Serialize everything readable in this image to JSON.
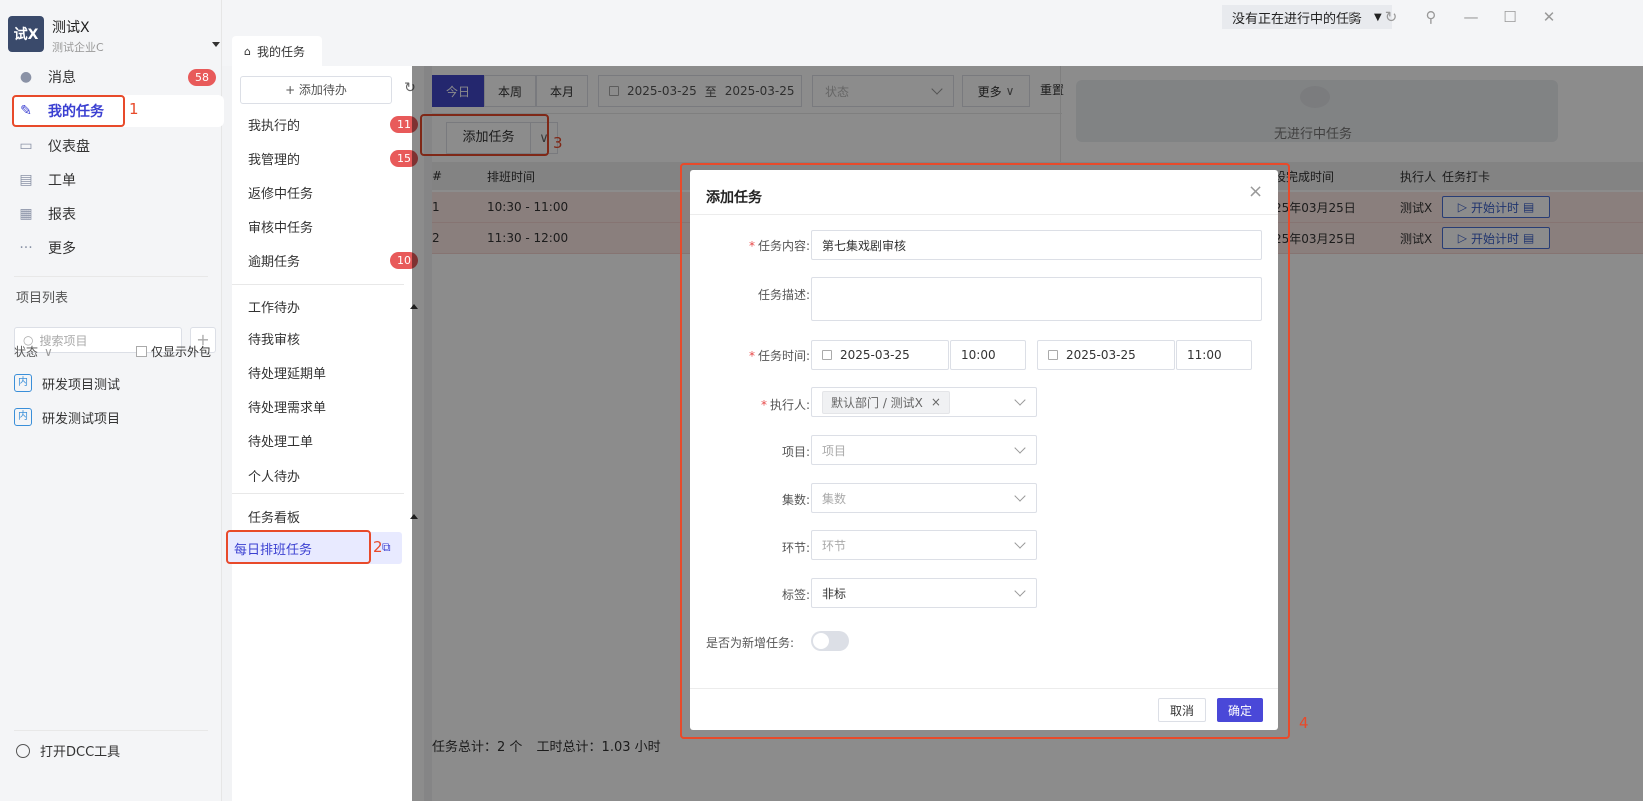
{
  "app": {
    "logo_text": "试X",
    "name": "测试X",
    "company": "测试企业C"
  },
  "sidebar": {
    "nav": [
      {
        "label": "消息",
        "icon": "message-icon",
        "badge": "58"
      },
      {
        "label": "我的任务",
        "icon": "task-icon",
        "badge": ""
      },
      {
        "label": "仪表盘",
        "icon": "dashboard-icon",
        "badge": ""
      },
      {
        "label": "工单",
        "icon": "workorder-icon",
        "badge": ""
      },
      {
        "label": "报表",
        "icon": "report-icon",
        "badge": ""
      },
      {
        "label": "更多",
        "icon": "more-icon",
        "badge": ""
      }
    ],
    "project_list_label": "项目列表",
    "search_placeholder": "搜索项目",
    "status_label": "状态",
    "outsource_only": "仅显示外包",
    "projects": [
      {
        "tag": "内",
        "name": "研发项目测试"
      },
      {
        "tag": "内",
        "name": "研发测试项目"
      }
    ],
    "open_dcc": "打开DCC工具"
  },
  "topbar": {
    "tab_home": "我的任务",
    "status_text": "没有正在进行中的任务"
  },
  "midpanel": {
    "add_todo": "+ 添加待办",
    "items": [
      {
        "label": "我执行的",
        "badge": "11"
      },
      {
        "label": "我管理的",
        "badge": "15"
      },
      {
        "label": "返修中任务",
        "badge": ""
      },
      {
        "label": "审核中任务",
        "badge": ""
      },
      {
        "label": "逾期任务",
        "badge": "10"
      }
    ],
    "group_work": "工作待办",
    "work_items": [
      "待我审核",
      "待处理延期单",
      "待处理需求单",
      "待处理工单",
      "个人待办"
    ],
    "group_board": "任务看板",
    "board_active": "每日排班任务"
  },
  "main": {
    "seg_today": "今日",
    "seg_week": "本周",
    "seg_month": "本月",
    "date_start": "2025-03-25",
    "date_sep": "至",
    "date_end": "2025-03-25",
    "status_placeholder": "状态",
    "more": "更多",
    "reset": "重置",
    "add_task": "添加任务",
    "no_task": "无进行中任务",
    "table_headers": {
      "idx": "#",
      "schedule": "排班时间",
      "finish": "设完成时间",
      "executor": "执行人",
      "clockin": "任务打卡"
    },
    "rows": [
      {
        "idx": "1",
        "time": "10:30 - 11:00",
        "finish": "25年03月25日",
        "executor": "测试X",
        "action": "开始计时"
      },
      {
        "idx": "2",
        "time": "11:30 - 12:00",
        "finish": "25年03月25日",
        "executor": "测试X",
        "action": "开始计时"
      }
    ],
    "footer_total": "任务总计：2 个",
    "footer_hours": "工时总计：1.03 小时"
  },
  "modal": {
    "title": "添加任务",
    "fields": {
      "content_label": "任务内容:",
      "content_value": "第七集戏剧审核",
      "desc_label": "任务描述:",
      "time_label": "任务时间:",
      "start_date": "2025-03-25",
      "start_time": "10:00",
      "end_date": "2025-03-25",
      "end_time": "11:00",
      "executor_label": "执行人:",
      "executor_tag": "默认部门 / 测试X",
      "project_label": "项目:",
      "project_placeholder": "项目",
      "episode_label": "集数:",
      "episode_placeholder": "集数",
      "stage_label": "环节:",
      "stage_placeholder": "环节",
      "tag_label": "标签:",
      "tag_value": "非标",
      "new_task_label": "是否为新增任务:"
    },
    "cancel": "取消",
    "ok": "确定"
  },
  "annotations": [
    "1",
    "2",
    "3",
    "4"
  ],
  "colors": {
    "accent": "#4248c8",
    "badge": "#e85a5a",
    "annotation": "#e84a2a"
  }
}
